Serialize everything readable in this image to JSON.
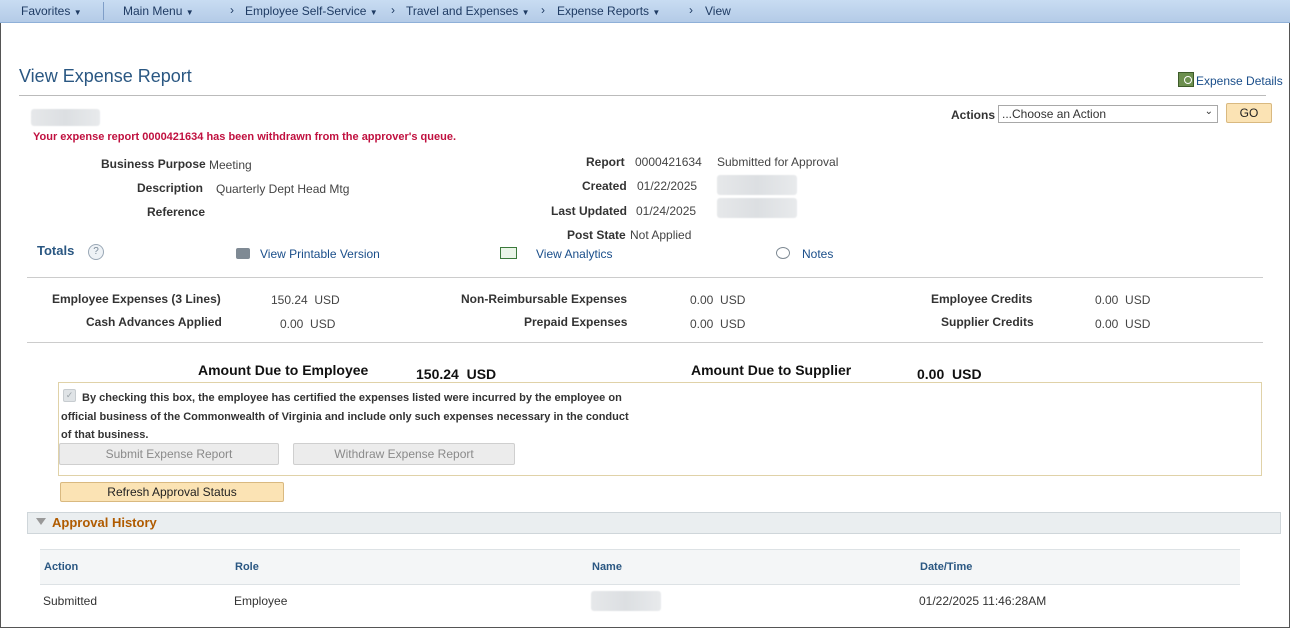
{
  "nav": {
    "favorites": "Favorites",
    "main_menu": "Main Menu",
    "crumbs": [
      "Employee Self-Service",
      "Travel and Expenses",
      "Expense Reports",
      "View"
    ]
  },
  "page": {
    "title": "View Expense Report",
    "expense_details_link": "Expense Details",
    "actions_label": "Actions",
    "actions_select_value": "...Choose an Action",
    "go_button": "GO",
    "message": "Your expense report 0000421634 has been withdrawn from the approver's queue."
  },
  "header_fields": {
    "business_purpose_label": "Business Purpose",
    "business_purpose_value": "Meeting",
    "description_label": "Description",
    "description_value": "Quarterly Dept Head Mtg",
    "reference_label": "Reference",
    "report_label": "Report",
    "report_value": "0000421634",
    "report_status": "Submitted for Approval",
    "created_label": "Created",
    "created_value": "01/22/2025",
    "last_updated_label": "Last Updated",
    "last_updated_value": "01/24/2025",
    "post_state_label": "Post State",
    "post_state_value": "Not Applied"
  },
  "totals": {
    "label": "Totals",
    "view_printable": "View Printable Version",
    "view_analytics": "View Analytics",
    "notes": "Notes",
    "employee_expenses_label": "Employee Expenses (3 Lines)",
    "employee_expenses_value": "150.24",
    "cash_advances_label": "Cash Advances Applied",
    "cash_advances_value": "0.00",
    "non_reimbursable_label": "Non-Reimbursable Expenses",
    "non_reimbursable_value": "0.00",
    "prepaid_label": "Prepaid Expenses",
    "prepaid_value": "0.00",
    "employee_credits_label": "Employee Credits",
    "employee_credits_value": "0.00",
    "supplier_credits_label": "Supplier Credits",
    "supplier_credits_value": "0.00",
    "currency": "USD",
    "amount_due_employee_label": "Amount Due to Employee",
    "amount_due_employee_value": "150.24  USD",
    "amount_due_supplier_label": "Amount Due to Supplier",
    "amount_due_supplier_value": "0.00  USD"
  },
  "certification": {
    "line1": "By checking this box, the employee has certified the expenses listed were incurred by the employee on",
    "line2": "official business of the Commonwealth of Virginia and include only such expenses necessary in the conduct",
    "line3": "of that business.",
    "checked": true,
    "submit_button": "Submit Expense Report",
    "withdraw_button": "Withdraw Expense Report",
    "refresh_button": "Refresh Approval Status"
  },
  "approval_history": {
    "title": "Approval History",
    "columns": [
      "Action",
      "Role",
      "Name",
      "Date/Time"
    ],
    "rows": [
      {
        "action": "Submitted",
        "role": "Employee",
        "name": "",
        "datetime": "01/22/2025 11:46:28AM"
      }
    ]
  },
  "colors": {
    "title_blue": "#2a5782",
    "link_blue": "#1a4e8a",
    "message_red": "#c0103f",
    "section_orange": "#b05b00",
    "nav_bg": "#c8dcf2",
    "go_button_bg": "#fbe3b4"
  }
}
